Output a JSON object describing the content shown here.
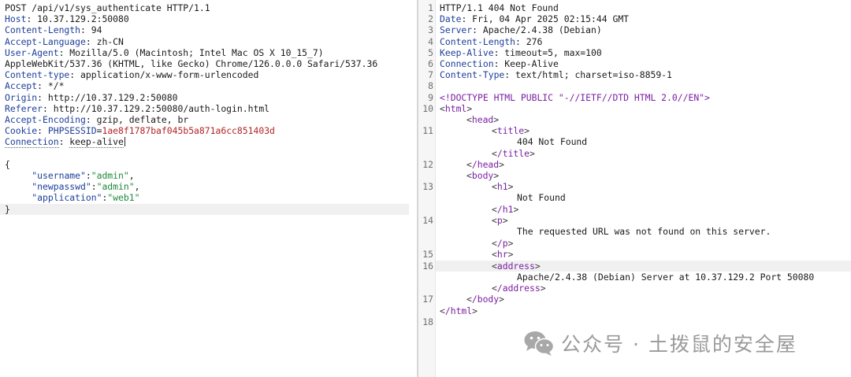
{
  "request": {
    "request_line": "POST /api/v1/sys_authenticate HTTP/1.1",
    "headers": [
      {
        "name": "Host",
        "value": "10.37.129.2:50080"
      },
      {
        "name": "Content-Length",
        "value": "94"
      },
      {
        "name": "Accept-Language",
        "value": "zh-CN"
      },
      {
        "name": "User-Agent",
        "value": "Mozilla/5.0 (Macintosh; Intel Mac OS X 10_15_7)"
      },
      {
        "name": "",
        "value": "AppleWebKit/537.36 (KHTML, like Gecko) Chrome/126.0.0.0 Safari/537.36"
      },
      {
        "name": "Content-type",
        "value": "application/x-www-form-urlencoded"
      },
      {
        "name": "Accept",
        "value": "*/*"
      },
      {
        "name": "Origin",
        "value": "http://10.37.129.2:50080"
      },
      {
        "name": "Referer",
        "value": "http://10.37.129.2:50080/auth-login.html"
      },
      {
        "name": "Accept-Encoding",
        "value": "gzip, deflate, br"
      },
      {
        "name": "Cookie",
        "value": "PHPSESSID=1ae8f1787baf045b5a871a6cc851403d"
      },
      {
        "name": "Connection",
        "value": "keep-alive"
      }
    ],
    "cookie_parts": {
      "name": "PHPSESSID",
      "eq": "=",
      "value": "1ae8f1787baf045b5a871a6cc851403d"
    },
    "body_open": "{",
    "body_fields": [
      {
        "key": "\"username\"",
        "sep": ":",
        "value": "\"admin\"",
        "end": ","
      },
      {
        "key": "\"newpasswd\"",
        "sep": ":",
        "value": "\"admin\"",
        "end": ","
      },
      {
        "key": "\"application\"",
        "sep": ":",
        "value": "\"web1\"",
        "end": ""
      }
    ],
    "body_close": "}"
  },
  "response": {
    "line_numbers": [
      "1",
      "2",
      "3",
      "4",
      "5",
      "6",
      "7",
      "8",
      "9",
      "10",
      "11",
      "12",
      "13",
      "14",
      "15",
      "16",
      "17",
      "18"
    ],
    "status_line": "HTTP/1.1 404 Not Found",
    "headers": [
      {
        "name": "Date",
        "value": "Fri, 04 Apr 2025 02:15:44 GMT"
      },
      {
        "name": "Server",
        "value": "Apache/2.4.38 (Debian)"
      },
      {
        "name": "Content-Length",
        "value": "276"
      },
      {
        "name": "Keep-Alive",
        "value": "timeout=5, max=100"
      },
      {
        "name": "Connection",
        "value": "Keep-Alive"
      },
      {
        "name": "Content-Type",
        "value": "text/html; charset=iso-8859-1"
      }
    ],
    "html": {
      "doctype": "<!DOCTYPE HTML PUBLIC \"-//IETF//DTD HTML 2.0//EN\">",
      "html_open": "html",
      "head_open": "head",
      "title_open": "title",
      "title_text": "404 Not Found",
      "title_close": "/title",
      "head_close": "/head",
      "body_open": "body",
      "h1_open": "h1",
      "h1_text": "Not Found",
      "h1_close": "/h1",
      "p_open": "p",
      "p_text": "The requested URL was not found on this server.",
      "p_close": "/p",
      "hr": "hr",
      "address_open": "address",
      "address_text": "Apache/2.4.38 (Debian) Server at 10.37.129.2 Port 50080",
      "address_close": "/address",
      "body_close": "/body",
      "html_close": "/html"
    }
  },
  "watermark": {
    "text": "公众号 · 土拨鼠的安全屋",
    "icon": "wechat-icon"
  }
}
